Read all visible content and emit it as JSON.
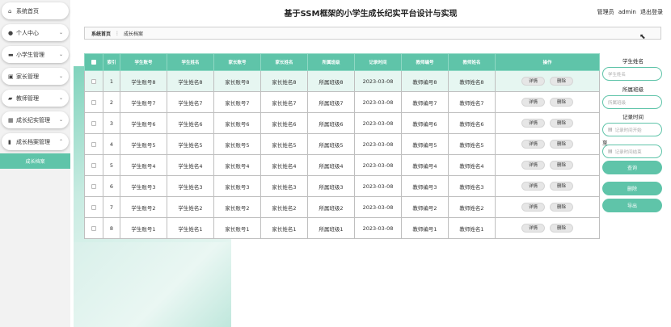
{
  "header": {
    "title": "基于SSM框架的小学生成长纪实平台设计与实现",
    "role": "管理员",
    "username": "admin",
    "logout_label": "退出登录"
  },
  "sidebar": {
    "items": [
      {
        "label": "系统首页",
        "icon": "home-icon",
        "has_chevron": false
      },
      {
        "label": "个人中心",
        "icon": "person-icon",
        "has_chevron": true
      },
      {
        "label": "小学生管理",
        "icon": "monitor-icon",
        "has_chevron": true
      },
      {
        "label": "家长管理",
        "icon": "clipboard-icon",
        "has_chevron": true
      },
      {
        "label": "教师管理",
        "icon": "folder-icon",
        "has_chevron": true
      },
      {
        "label": "成长纪实管理",
        "icon": "grid-icon",
        "has_chevron": true
      },
      {
        "label": "成长档案管理",
        "icon": "chart-icon",
        "has_chevron": true
      }
    ],
    "active_sub_item": "成长档案"
  },
  "breadcrumb": {
    "home": "系统首页",
    "current": "成长档案"
  },
  "table": {
    "columns": [
      "索引",
      "学生账号",
      "学生姓名",
      "家长账号",
      "家长姓名",
      "所属班级",
      "记录时间",
      "教师编号",
      "教师姓名",
      "操作"
    ],
    "detail_label": "详情",
    "delete_label": "删除",
    "rows": [
      {
        "index": "1",
        "student_account": "学生账号8",
        "student_name": "学生姓名8",
        "parent_account": "家长账号8",
        "parent_name": "家长姓名8",
        "class": "所属班级8",
        "time": "2023-03-08",
        "teacher_no": "教师编号8",
        "teacher_name": "教师姓名8"
      },
      {
        "index": "2",
        "student_account": "学生账号7",
        "student_name": "学生姓名7",
        "parent_account": "家长账号7",
        "parent_name": "家长姓名7",
        "class": "所属班级7",
        "time": "2023-03-08",
        "teacher_no": "教师编号7",
        "teacher_name": "教师姓名7"
      },
      {
        "index": "3",
        "student_account": "学生账号6",
        "student_name": "学生姓名6",
        "parent_account": "家长账号6",
        "parent_name": "家长姓名6",
        "class": "所属班级6",
        "time": "2023-03-08",
        "teacher_no": "教师编号6",
        "teacher_name": "教师姓名6"
      },
      {
        "index": "4",
        "student_account": "学生账号5",
        "student_name": "学生姓名5",
        "parent_account": "家长账号5",
        "parent_name": "家长姓名5",
        "class": "所属班级5",
        "time": "2023-03-08",
        "teacher_no": "教师编号5",
        "teacher_name": "教师姓名5"
      },
      {
        "index": "5",
        "student_account": "学生账号4",
        "student_name": "学生姓名4",
        "parent_account": "家长账号4",
        "parent_name": "家长姓名4",
        "class": "所属班级4",
        "time": "2023-03-08",
        "teacher_no": "教师编号4",
        "teacher_name": "教师姓名4"
      },
      {
        "index": "6",
        "student_account": "学生账号3",
        "student_name": "学生姓名3",
        "parent_account": "家长账号3",
        "parent_name": "家长姓名3",
        "class": "所属班级3",
        "time": "2023-03-08",
        "teacher_no": "教师编号3",
        "teacher_name": "教师姓名3"
      },
      {
        "index": "7",
        "student_account": "学生账号2",
        "student_name": "学生姓名2",
        "parent_account": "家长账号2",
        "parent_name": "家长姓名2",
        "class": "所属班级2",
        "time": "2023-03-08",
        "teacher_no": "教师编号2",
        "teacher_name": "教师姓名2"
      },
      {
        "index": "8",
        "student_account": "学生账号1",
        "student_name": "学生姓名1",
        "parent_account": "家长账号1",
        "parent_name": "家长姓名1",
        "class": "所属班级1",
        "time": "2023-03-08",
        "teacher_no": "教师编号1",
        "teacher_name": "教师姓名1"
      }
    ]
  },
  "search": {
    "student_name_label": "学生姓名",
    "student_name_placeholder": "学生姓名",
    "class_label": "所属班级",
    "class_placeholder": "所属班级",
    "time_label": "记录时间",
    "start_placeholder": "记录时间开始",
    "to_label": "至",
    "end_placeholder": "记录时间结束",
    "query_label": "查询",
    "delete_label": "删除",
    "export_label": "导出"
  },
  "colors": {
    "accent": "#5fc4a9",
    "highlight_row": "#e6f6f1"
  }
}
